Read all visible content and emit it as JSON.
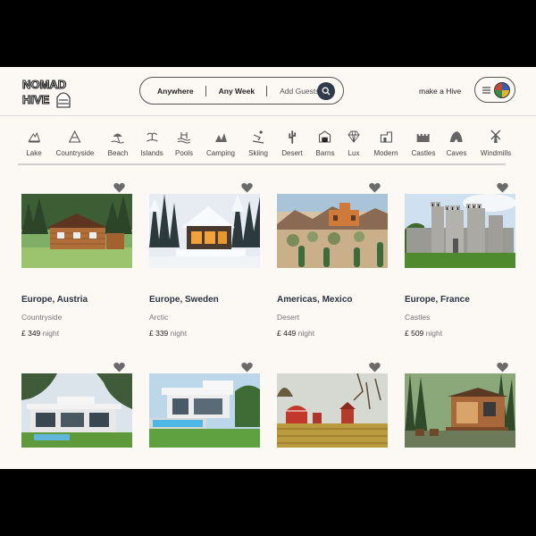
{
  "header": {
    "logo_text": "NOMAD HIVE",
    "search": {
      "where": "Anywhere",
      "when": "Any Week",
      "guests": "Add Guests"
    },
    "host_link": "make a Hive"
  },
  "categories": [
    {
      "label": "Lake",
      "icon": "lake-icon"
    },
    {
      "label": "Countryside",
      "icon": "countryside-icon"
    },
    {
      "label": "Beach",
      "icon": "beach-icon"
    },
    {
      "label": "Islands",
      "icon": "islands-icon"
    },
    {
      "label": "Pools",
      "icon": "pools-icon"
    },
    {
      "label": "Camping",
      "icon": "camping-icon"
    },
    {
      "label": "Skiing",
      "icon": "skiing-icon"
    },
    {
      "label": "Desert",
      "icon": "desert-icon"
    },
    {
      "label": "Barns",
      "icon": "barns-icon"
    },
    {
      "label": "Lux",
      "icon": "lux-icon"
    },
    {
      "label": "Modern",
      "icon": "modern-icon"
    },
    {
      "label": "Castles",
      "icon": "castles-icon"
    },
    {
      "label": "Caves",
      "icon": "caves-icon"
    },
    {
      "label": "Windmills",
      "icon": "windmills-icon"
    }
  ],
  "listings": [
    {
      "location": "Europe, Austria",
      "type": "Countryside",
      "price": "£ 349",
      "unit": "night"
    },
    {
      "location": "Europe, Sweden",
      "type": "Arctic",
      "price": "£ 339",
      "unit": "night"
    },
    {
      "location": "Americas, Mexico",
      "type": "Desert",
      "price": "£ 449",
      "unit": "night"
    },
    {
      "location": "Europe, France",
      "type": "Castles",
      "price": "£ 509",
      "unit": "night"
    }
  ],
  "colors": {
    "page_bg": "#fcf8f4",
    "accent": "#2f3a4a",
    "heart": "#6b6b6b"
  }
}
